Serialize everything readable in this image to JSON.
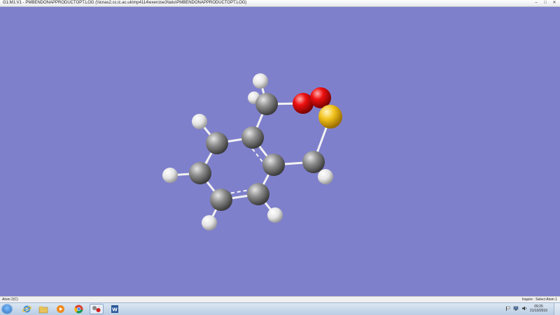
{
  "window": {
    "title": "G1:M1:V1 - PMBENDONAPPRODUCTOPT.LOG (\\\\icnas2.cc.ic.ac.uk\\mp4114\\exercise3\\tatu\\PMBENDONAPPRODUCTOPT.LOG)",
    "minimize": "–",
    "maximize": "□",
    "close": "✕"
  },
  "colors": {
    "background": "#7f80cc",
    "carbon": "#8a8a8a",
    "hydrogen": "#e8e8e8",
    "oxygen": "#e00000",
    "sulfur": "#f0c020",
    "bond": "#f2f2f2"
  },
  "molecule": {
    "atom_types": [
      "H",
      "H",
      "C",
      "O",
      "O",
      "S",
      "H",
      "C",
      "C",
      "C",
      "C",
      "C",
      "C",
      "H",
      "H",
      "H",
      "H",
      "C",
      "H"
    ]
  },
  "status": {
    "left": "Atom 2(C)",
    "right": "Inquire : Select Atom 1"
  },
  "taskbar": {
    "apps": [
      {
        "name": "internet-explorer-icon",
        "active": false
      },
      {
        "name": "file-explorer-icon",
        "active": false
      },
      {
        "name": "media-player-icon",
        "active": false
      },
      {
        "name": "chrome-icon",
        "active": false
      },
      {
        "name": "gaussview-icon",
        "active": true
      },
      {
        "name": "word-icon",
        "active": false
      }
    ],
    "time": "09:25",
    "date": "21/10/2016"
  }
}
